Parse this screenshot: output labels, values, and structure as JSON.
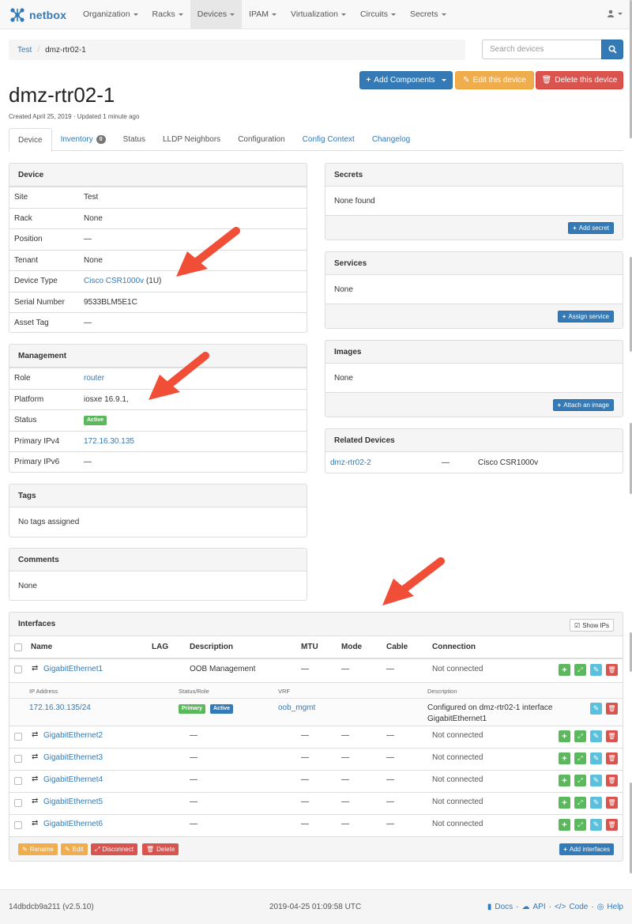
{
  "brand": {
    "name": "netbox"
  },
  "nav": {
    "items": [
      {
        "label": "Organization"
      },
      {
        "label": "Racks"
      },
      {
        "label": "Devices"
      },
      {
        "label": "IPAM"
      },
      {
        "label": "Virtualization"
      },
      {
        "label": "Circuits"
      },
      {
        "label": "Secrets"
      }
    ]
  },
  "breadcrumb": {
    "site": "Test",
    "device": "dmz-rtr02-1"
  },
  "search": {
    "placeholder": "Search devices"
  },
  "actions": {
    "add_components": "Add Components",
    "edit_device": "Edit this device",
    "delete_device": "Delete this device"
  },
  "device": {
    "name": "dmz-rtr02-1",
    "subtitle": "Created April 25, 2019 · Updated 1 minute ago"
  },
  "tabs": [
    {
      "label": "Device"
    },
    {
      "label": "Inventory",
      "badge": "0"
    },
    {
      "label": "Status"
    },
    {
      "label": "LLDP Neighbors"
    },
    {
      "label": "Configuration"
    },
    {
      "label": "Config Context"
    },
    {
      "label": "Changelog"
    }
  ],
  "device_panel": {
    "title": "Device",
    "rows": [
      {
        "label": "Site",
        "value": "Test"
      },
      {
        "label": "Rack",
        "value": "None"
      },
      {
        "label": "Position",
        "value": "—"
      },
      {
        "label": "Tenant",
        "value": "None"
      },
      {
        "label": "Device Type",
        "value": "Cisco CSR1000v",
        "suffix": "(1U)"
      },
      {
        "label": "Serial Number",
        "value": "9533BLM5E1C"
      },
      {
        "label": "Asset Tag",
        "value": "—"
      }
    ]
  },
  "management_panel": {
    "title": "Management",
    "rows": [
      {
        "label": "Role",
        "value": "router"
      },
      {
        "label": "Platform",
        "value": "iosxe 16.9.1,"
      },
      {
        "label": "Status",
        "value": "Active"
      },
      {
        "label": "Primary IPv4",
        "value": "172.16.30.135"
      },
      {
        "label": "Primary IPv6",
        "value": "—"
      }
    ]
  },
  "tags_panel": {
    "title": "Tags",
    "body": "No tags assigned"
  },
  "comments_panel": {
    "title": "Comments",
    "body": "None"
  },
  "secrets_panel": {
    "title": "Secrets",
    "body": "None found",
    "button": "Add secret"
  },
  "services_panel": {
    "title": "Services",
    "body": "None",
    "button": "Assign service"
  },
  "images_panel": {
    "title": "Images",
    "body": "None",
    "button": "Attach an image"
  },
  "related_panel": {
    "title": "Related Devices",
    "rows": [
      {
        "name": "dmz-rtr02-2",
        "dash": "—",
        "type": "Cisco CSR1000v"
      }
    ]
  },
  "interfaces": {
    "title": "Interfaces",
    "show_ips": "Show IPs",
    "columns": [
      "Name",
      "LAG",
      "Description",
      "MTU",
      "Mode",
      "Cable",
      "Connection"
    ],
    "rows": [
      {
        "name": "GigabitEthernet1",
        "description": "OOB Management",
        "mtu": "—",
        "mode": "—",
        "cable": "—",
        "connection": "Not connected"
      },
      {
        "name": "GigabitEthernet2",
        "description": "—",
        "mtu": "—",
        "mode": "—",
        "cable": "—",
        "connection": "Not connected"
      },
      {
        "name": "GigabitEthernet3",
        "description": "—",
        "mtu": "—",
        "mode": "—",
        "cable": "—",
        "connection": "Not connected"
      },
      {
        "name": "GigabitEthernet4",
        "description": "—",
        "mtu": "—",
        "mode": "—",
        "cable": "—",
        "connection": "Not connected"
      },
      {
        "name": "GigabitEthernet5",
        "description": "—",
        "mtu": "—",
        "mode": "—",
        "cable": "—",
        "connection": "Not connected"
      },
      {
        "name": "GigabitEthernet6",
        "description": "—",
        "mtu": "—",
        "mode": "—",
        "cable": "—",
        "connection": "Not connected"
      }
    ],
    "ip_columns": [
      "IP Address",
      "Status/Role",
      "VRF",
      "Description"
    ],
    "ip_row": {
      "address": "172.16.30.135/24",
      "role": "Primary",
      "status": "Active",
      "vrf": "oob_mgmt",
      "description_line1": "Configured on dmz-rtr02-1 interface",
      "description_line2": "GigabitEthernet1"
    },
    "footer_buttons": {
      "rename": "Rename",
      "edit": "Edit",
      "disconnect": "Disconnect",
      "delete": "Delete",
      "add": "Add interfaces"
    }
  },
  "footer": {
    "version": "14dbdcb9a211 (v2.5.10)",
    "timestamp": "2019-04-25 01:09:58 UTC",
    "links": {
      "docs": "Docs",
      "api": "API",
      "code": "Code",
      "help": "Help"
    }
  },
  "colors": {
    "primary": "#337ab7",
    "success": "#5cb85c",
    "warning": "#f0ad4e",
    "danger": "#d9534f",
    "info": "#5bc0de",
    "arrow": "#f04e37"
  }
}
